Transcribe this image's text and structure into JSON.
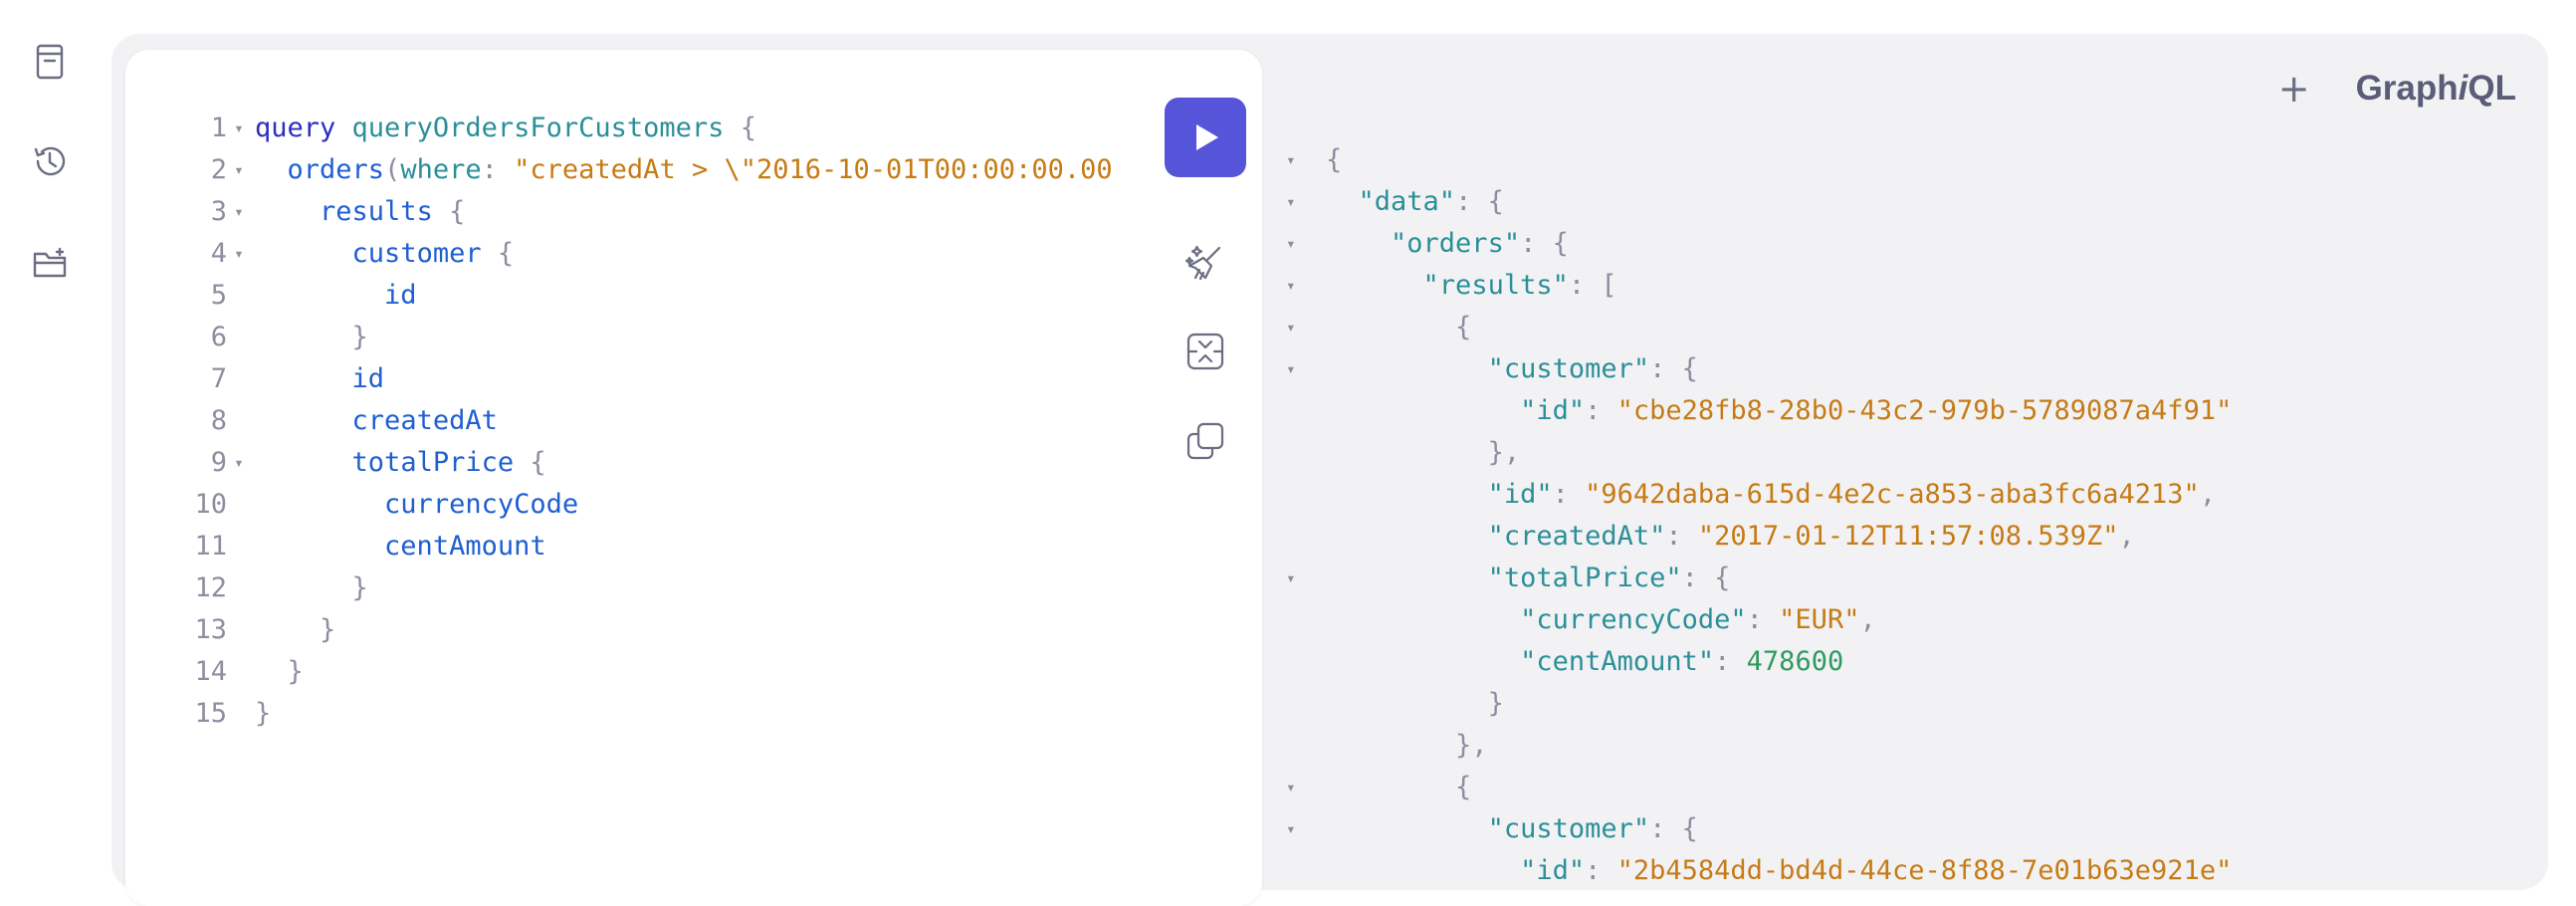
{
  "sidebar": {
    "items": [
      {
        "icon": "document-icon",
        "label": "Documentation"
      },
      {
        "icon": "history-icon",
        "label": "History"
      },
      {
        "icon": "folder-icon",
        "label": "Collections"
      }
    ]
  },
  "header": {
    "plus": "+",
    "logo_prefix": "Graph",
    "logo_italic": "i",
    "logo_suffix": "QL"
  },
  "colors": {
    "run_button": "#5655d9",
    "panel_bg": "#f2f2f4",
    "keyword": "#2b2ec0",
    "field": "#1f5fd1",
    "string": "#c67b14",
    "number": "#2e9a5f"
  },
  "editor": {
    "lines": [
      {
        "n": "1",
        "fold": true,
        "tokens": [
          [
            "kw",
            "query"
          ],
          [
            "sp",
            " "
          ],
          [
            "def",
            "queryOrdersForCustomers"
          ],
          [
            "sp",
            " "
          ],
          [
            "punc",
            "{"
          ]
        ]
      },
      {
        "n": "2",
        "fold": true,
        "tokens": [
          [
            "sp",
            "  "
          ],
          [
            "field",
            "orders"
          ],
          [
            "punc",
            "("
          ],
          [
            "arg",
            "where"
          ],
          [
            "punc",
            ":"
          ],
          [
            "sp",
            " "
          ],
          [
            "str",
            "\"createdAt > \\\"2016-10-01T00:00:00.00"
          ]
        ]
      },
      {
        "n": "3",
        "fold": true,
        "tokens": [
          [
            "sp",
            "    "
          ],
          [
            "field",
            "results"
          ],
          [
            "sp",
            " "
          ],
          [
            "punc",
            "{"
          ]
        ]
      },
      {
        "n": "4",
        "fold": true,
        "tokens": [
          [
            "sp",
            "      "
          ],
          [
            "field",
            "customer"
          ],
          [
            "sp",
            " "
          ],
          [
            "punc",
            "{"
          ]
        ]
      },
      {
        "n": "5",
        "fold": false,
        "tokens": [
          [
            "sp",
            "        "
          ],
          [
            "field",
            "id"
          ]
        ]
      },
      {
        "n": "6",
        "fold": false,
        "tokens": [
          [
            "sp",
            "      "
          ],
          [
            "punc",
            "}"
          ]
        ]
      },
      {
        "n": "7",
        "fold": false,
        "tokens": [
          [
            "sp",
            "      "
          ],
          [
            "field",
            "id"
          ]
        ]
      },
      {
        "n": "8",
        "fold": false,
        "tokens": [
          [
            "sp",
            "      "
          ],
          [
            "field",
            "createdAt"
          ]
        ]
      },
      {
        "n": "9",
        "fold": true,
        "tokens": [
          [
            "sp",
            "      "
          ],
          [
            "field",
            "totalPrice"
          ],
          [
            "sp",
            " "
          ],
          [
            "punc",
            "{"
          ]
        ]
      },
      {
        "n": "10",
        "fold": false,
        "tokens": [
          [
            "sp",
            "        "
          ],
          [
            "field",
            "currencyCode"
          ]
        ]
      },
      {
        "n": "11",
        "fold": false,
        "tokens": [
          [
            "sp",
            "        "
          ],
          [
            "field",
            "centAmount"
          ]
        ]
      },
      {
        "n": "12",
        "fold": false,
        "tokens": [
          [
            "sp",
            "      "
          ],
          [
            "punc",
            "}"
          ]
        ]
      },
      {
        "n": "13",
        "fold": false,
        "tokens": [
          [
            "sp",
            "    "
          ],
          [
            "punc",
            "}"
          ]
        ]
      },
      {
        "n": "14",
        "fold": false,
        "tokens": [
          [
            "sp",
            "  "
          ],
          [
            "punc",
            "}"
          ]
        ]
      },
      {
        "n": "15",
        "fold": false,
        "tokens": [
          [
            "punc",
            "}"
          ]
        ]
      }
    ]
  },
  "toolbar": {
    "run_icon": "play-icon",
    "prettify_icon": "prettify-icon",
    "merge_icon": "merge-icon",
    "copy_icon": "copy-icon"
  },
  "result": {
    "lines": [
      {
        "fold": true,
        "tokens": [
          [
            "punc",
            "{"
          ]
        ]
      },
      {
        "fold": true,
        "tokens": [
          [
            "sp",
            "  "
          ],
          [
            "prop",
            "\"data\""
          ],
          [
            "punc",
            ": {"
          ]
        ]
      },
      {
        "fold": true,
        "tokens": [
          [
            "sp",
            "    "
          ],
          [
            "prop",
            "\"orders\""
          ],
          [
            "punc",
            ": {"
          ]
        ]
      },
      {
        "fold": true,
        "tokens": [
          [
            "sp",
            "      "
          ],
          [
            "prop",
            "\"results\""
          ],
          [
            "punc",
            ": ["
          ]
        ]
      },
      {
        "fold": true,
        "tokens": [
          [
            "sp",
            "        "
          ],
          [
            "punc",
            "{"
          ]
        ]
      },
      {
        "fold": true,
        "tokens": [
          [
            "sp",
            "          "
          ],
          [
            "prop",
            "\"customer\""
          ],
          [
            "punc",
            ": {"
          ]
        ]
      },
      {
        "fold": false,
        "tokens": [
          [
            "sp",
            "            "
          ],
          [
            "prop",
            "\"id\""
          ],
          [
            "punc",
            ": "
          ],
          [
            "str",
            "\"cbe28fb8-28b0-43c2-979b-5789087a4f91\""
          ]
        ]
      },
      {
        "fold": false,
        "tokens": [
          [
            "sp",
            "          "
          ],
          [
            "punc",
            "},"
          ]
        ]
      },
      {
        "fold": false,
        "tokens": [
          [
            "sp",
            "          "
          ],
          [
            "prop",
            "\"id\""
          ],
          [
            "punc",
            ": "
          ],
          [
            "str",
            "\"9642daba-615d-4e2c-a853-aba3fc6a4213\""
          ],
          [
            "punc",
            ","
          ]
        ]
      },
      {
        "fold": false,
        "tokens": [
          [
            "sp",
            "          "
          ],
          [
            "prop",
            "\"createdAt\""
          ],
          [
            "punc",
            ": "
          ],
          [
            "str",
            "\"2017-01-12T11:57:08.539Z\""
          ],
          [
            "punc",
            ","
          ]
        ]
      },
      {
        "fold": true,
        "tokens": [
          [
            "sp",
            "          "
          ],
          [
            "prop",
            "\"totalPrice\""
          ],
          [
            "punc",
            ": {"
          ]
        ]
      },
      {
        "fold": false,
        "tokens": [
          [
            "sp",
            "            "
          ],
          [
            "prop",
            "\"currencyCode\""
          ],
          [
            "punc",
            ": "
          ],
          [
            "str",
            "\"EUR\""
          ],
          [
            "punc",
            ","
          ]
        ]
      },
      {
        "fold": false,
        "tokens": [
          [
            "sp",
            "            "
          ],
          [
            "prop",
            "\"centAmount\""
          ],
          [
            "punc",
            ": "
          ],
          [
            "num",
            "478600"
          ]
        ]
      },
      {
        "fold": false,
        "tokens": [
          [
            "sp",
            "          "
          ],
          [
            "punc",
            "}"
          ]
        ]
      },
      {
        "fold": false,
        "tokens": [
          [
            "sp",
            "        "
          ],
          [
            "punc",
            "},"
          ]
        ]
      },
      {
        "fold": true,
        "tokens": [
          [
            "sp",
            "        "
          ],
          [
            "punc",
            "{"
          ]
        ]
      },
      {
        "fold": true,
        "tokens": [
          [
            "sp",
            "          "
          ],
          [
            "prop",
            "\"customer\""
          ],
          [
            "punc",
            ": {"
          ]
        ]
      },
      {
        "fold": false,
        "tokens": [
          [
            "sp",
            "            "
          ],
          [
            "prop",
            "\"id\""
          ],
          [
            "punc",
            ": "
          ],
          [
            "str",
            "\"2b4584dd-bd4d-44ce-8f88-7e01b63e921e\""
          ]
        ]
      }
    ]
  }
}
